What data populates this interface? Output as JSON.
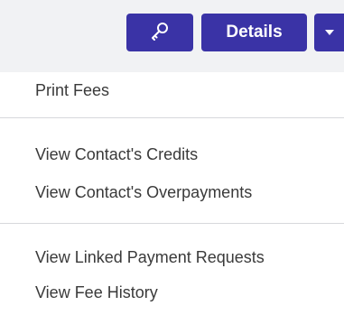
{
  "toolbar": {
    "key_icon": "key-icon",
    "details_label": "Details",
    "caret_icon": "caret-down-icon",
    "button_color": "#3a33a6"
  },
  "menu": {
    "items": [
      {
        "label": "Print Fees"
      },
      {
        "label": "View Contact's Credits"
      },
      {
        "label": "View Contact's Overpayments"
      },
      {
        "label": "View Linked Payment Requests"
      },
      {
        "label": "View Fee History"
      }
    ]
  }
}
